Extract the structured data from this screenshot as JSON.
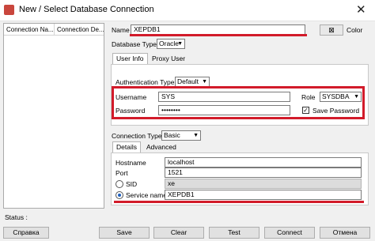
{
  "window": {
    "title": "New / Select Database Connection",
    "close_glyph": "✕"
  },
  "list": {
    "columns": [
      "Connection Na...",
      "Connection De..."
    ]
  },
  "form": {
    "name_label": "Name",
    "name_value": "XEPDB1",
    "color_label": "Color",
    "db_type_label": "Database Type",
    "db_type_value": "Oracle",
    "tabs": [
      "User Info",
      "Proxy User"
    ],
    "auth_type_label": "Authentication Type",
    "auth_type_value": "Default",
    "username_label": "Username",
    "username_value": "SYS",
    "password_label": "Password",
    "password_value": "••••••••",
    "role_label": "Role",
    "role_value": "SYSDBA",
    "save_password_label": "Save Password",
    "save_password_checked": true,
    "conn_type_label": "Connection Type",
    "conn_type_value": "Basic",
    "detail_tabs": [
      "Details",
      "Advanced"
    ],
    "hostname_label": "Hostname",
    "hostname_value": "localhost",
    "port_label": "Port",
    "port_value": "1521",
    "sid_label": "SID",
    "sid_value": "xe",
    "service_label": "Service name",
    "service_value": "XEPDB1"
  },
  "status": {
    "label": "Status :"
  },
  "buttons": {
    "help": "Справка",
    "save": "Save",
    "clear": "Clear",
    "test": "Test",
    "connect": "Connect",
    "cancel": "Отмена"
  },
  "colors": {
    "highlight": "#d21b2a",
    "accent": "#1f5fbf"
  },
  "icons": {
    "app": "oracle-sqldev-icon",
    "color_picker": "color-x-icon"
  }
}
